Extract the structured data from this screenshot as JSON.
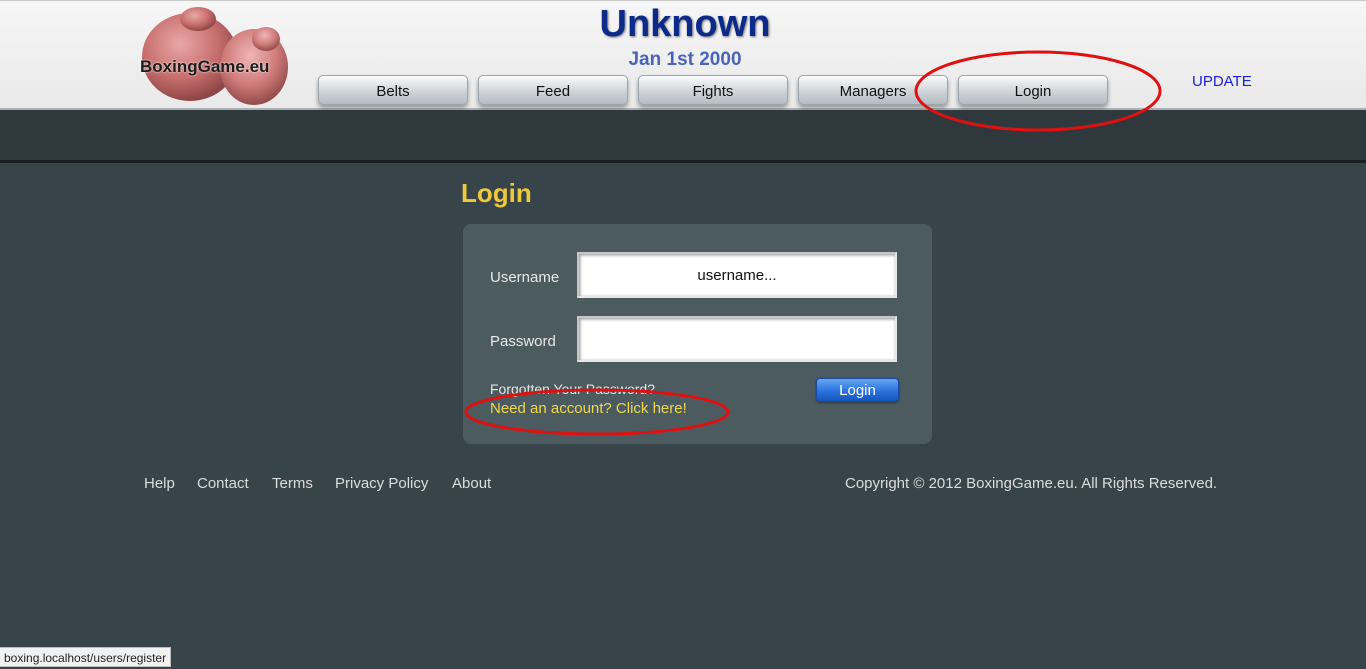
{
  "header": {
    "logo_text": "BoxingGame.eu",
    "title": "Unknown",
    "date": "Jan 1st 2000",
    "nav": [
      "Belts",
      "Feed",
      "Fights",
      "Managers",
      "Login"
    ],
    "update_label": "UPDATE"
  },
  "main": {
    "heading": "Login",
    "form": {
      "username_label": "Username",
      "username_placeholder": "username...",
      "password_label": "Password",
      "forgot_link": "Forgotten Your Password?",
      "register_link": "Need an account? Click here!",
      "submit_label": "Login"
    }
  },
  "footer": {
    "links": [
      "Help",
      "Contact",
      "Terms",
      "Privacy Policy",
      "About"
    ],
    "copyright": "Copyright © 2012 BoxingGame.eu. All Rights Reserved."
  },
  "status_bar": {
    "url": "boxing.localhost/users/register"
  },
  "colors": {
    "annotation": "#e01010",
    "heading": "#f0c93a",
    "register_link": "#f0d84a",
    "title": "#0c2a8a"
  }
}
